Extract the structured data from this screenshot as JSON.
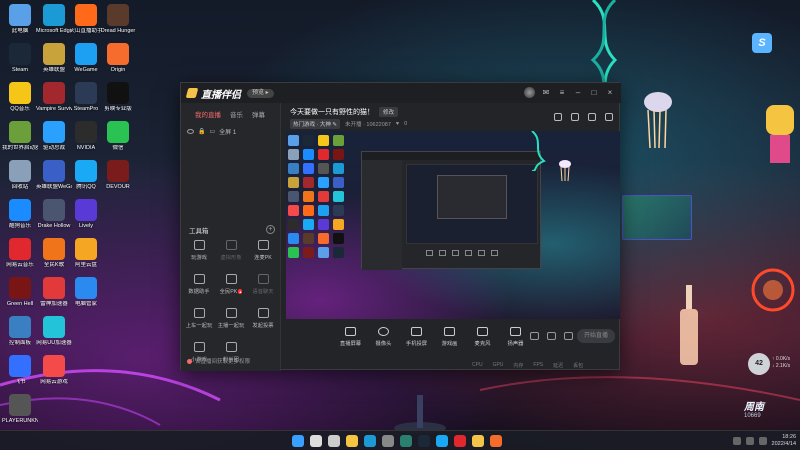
{
  "desktop": {
    "icons": [
      {
        "label": "此电脑",
        "color": "#5aa0e8"
      },
      {
        "label": "Steam",
        "color": "#1b2838"
      },
      {
        "label": "QQ音乐",
        "color": "#f5c518"
      },
      {
        "label": "我的世界启动器",
        "color": "#6a9f3a"
      },
      {
        "label": "回收站",
        "color": "#8aa0b8"
      },
      {
        "label": "酷狗音乐",
        "color": "#1a8cff"
      },
      {
        "label": "网易云音乐",
        "color": "#e0282e"
      },
      {
        "label": "Green Hell",
        "color": "#7a1515"
      },
      {
        "label": "控制面板",
        "color": "#3a7fc2"
      },
      {
        "label": "飞书",
        "color": "#3370ff"
      },
      {
        "label": "PLAYERUNKNOWN'S BATTLEGROUNDS",
        "color": "#555"
      },
      {
        "label": "Microsoft Edge",
        "color": "#1c9ad6"
      },
      {
        "label": "英雄联盟",
        "color": "#c8a23a"
      },
      {
        "label": "Vampire Survivors",
        "color": "#a2282d"
      },
      {
        "label": "驱动总裁",
        "color": "#2aa0ff"
      },
      {
        "label": "英雄联盟WeGame",
        "color": "#3a60c8"
      },
      {
        "label": "Drake Hollow",
        "color": "#4a5570"
      },
      {
        "label": "全民K歌",
        "color": "#f0741a"
      },
      {
        "label": "雷神加速器",
        "color": "#e23a3a"
      },
      {
        "label": "网易UU加速器",
        "color": "#23c4d9"
      },
      {
        "label": "网易云游戏",
        "color": "#f54a4a"
      },
      {
        "label": "火山直播助手",
        "color": "#ff6a1a"
      },
      {
        "label": "WeGame",
        "color": "#1da0f2"
      },
      {
        "label": "SteamPro",
        "color": "#2b3b55"
      },
      {
        "label": "NVIDIA",
        "color": "#2c2c2c"
      },
      {
        "label": "腾讯QQ",
        "color": "#1aaaf5"
      },
      {
        "label": "Lively",
        "color": "#5a3ad6"
      },
      {
        "label": "阿里云盘",
        "color": "#f5a623"
      },
      {
        "label": "电脑管家",
        "color": "#2a8aef"
      },
      {
        "label": "Dread Hunger",
        "color": "#5a3a2a"
      },
      {
        "label": "Origin",
        "color": "#f56c2d"
      },
      {
        "label": "剪映专业版",
        "color": "#111"
      },
      {
        "label": "微信",
        "color": "#2ac253"
      },
      {
        "label": "DEVOUR",
        "color": "#7a1c1c"
      }
    ]
  },
  "window": {
    "app_name": "直播伴侣",
    "version_pill": "预览 ▸",
    "sidebar": {
      "tabs": [
        "我的直播",
        "音乐",
        "弹幕"
      ],
      "active_tab": 0,
      "scene_label": "全屏 1",
      "tools_title": "工具箱",
      "tools": [
        {
          "label": "玩游戏",
          "dim": false,
          "hot": false
        },
        {
          "label": "虚拟形象",
          "dim": true,
          "hot": false
        },
        {
          "label": "连麦PK",
          "dim": false,
          "hot": false
        },
        {
          "label": "数据助手",
          "dim": false,
          "hot": false
        },
        {
          "label": "全民PK",
          "dim": false,
          "hot": true
        },
        {
          "label": "语音聊天",
          "dim": true,
          "hot": false
        },
        {
          "label": "上车一起玩",
          "dim": false,
          "hot": false
        },
        {
          "label": "主播一起玩",
          "dim": false,
          "hot": false
        },
        {
          "label": "发起投票",
          "dim": false,
          "hot": false
        },
        {
          "label": "小游戏",
          "dim": false,
          "hot": false
        },
        {
          "label": "粉丝团",
          "dim": false,
          "hot": false
        }
      ],
      "footer": "去直播间获取更多权限"
    },
    "main": {
      "stream_title": "今天要做一只有野性的猫！",
      "modify_label": "修改",
      "category": "热门游戏 · 大神 ✎",
      "room_meta": "未开播 · 10622087",
      "likes": "0",
      "controls": [
        {
          "label": "直播屏幕",
          "round": false
        },
        {
          "label": "摄像头",
          "round": true
        },
        {
          "label": "手机投屏",
          "round": false
        },
        {
          "label": "游戏画",
          "round": false
        },
        {
          "label": "麦克风",
          "round": false
        },
        {
          "label": "扬声器",
          "round": false
        }
      ],
      "live_button": "开始直播",
      "status": [
        "CPU",
        "GPU",
        "内存",
        "FPS",
        "延迟",
        "丢包"
      ]
    }
  },
  "overlays": {
    "meter_value": "42",
    "meter_unit": "%",
    "meter_line1": "↑ 0.0K/s",
    "meter_line2": "↓ 2.1K/s",
    "brand_line1": "周南",
    "brand_line2": "10669",
    "brand_line3": "直播",
    "tray_app_letter": "S"
  },
  "taskbar": {
    "apps": [
      {
        "name": "windows-start-icon",
        "color": "#3aa0ff"
      },
      {
        "name": "search-icon",
        "color": "#ddd"
      },
      {
        "name": "task-view-icon",
        "color": "#ccc"
      },
      {
        "name": "file-explorer-icon",
        "color": "#f5c542"
      },
      {
        "name": "edge-icon",
        "color": "#1c9ad6"
      },
      {
        "name": "settings-icon",
        "color": "#888"
      },
      {
        "name": "terminal-icon",
        "color": "#2a7f6e"
      },
      {
        "name": "steam-icon",
        "color": "#1b2838"
      },
      {
        "name": "qq-icon",
        "color": "#1aaaf5"
      },
      {
        "name": "music-icon",
        "color": "#e0282e"
      },
      {
        "name": "live-companion-icon",
        "color": "#f6c34a"
      },
      {
        "name": "app-icon",
        "color": "#f56c2d"
      }
    ],
    "time": "18:26",
    "date": "2022/4/14"
  }
}
